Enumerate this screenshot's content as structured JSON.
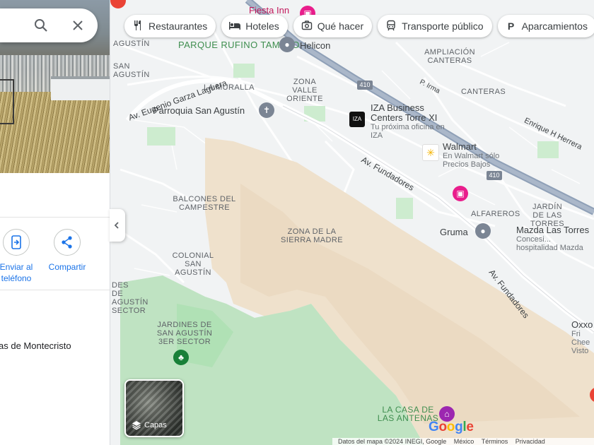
{
  "search": {
    "query": ""
  },
  "panel": {
    "actions": [
      {
        "label": "Enviar al\nteléfono"
      },
      {
        "label": "Compartir"
      }
    ],
    "address_fragment": "as de Montecristo"
  },
  "chips": [
    {
      "label": "Restaurantes",
      "icon": "restaurant-icon"
    },
    {
      "label": "Hoteles",
      "icon": "hotel-icon"
    },
    {
      "label": "Qué hacer",
      "icon": "camera-icon"
    },
    {
      "label": "Transporte público",
      "icon": "transit-icon"
    },
    {
      "label": "Aparcamientos",
      "icon": "parking-icon"
    }
  ],
  "map": {
    "areas": [
      "PARQUE RUFINO TAMAYO",
      "ZONA VALLE ORIENTE",
      "LA MURALLA",
      "AMPLIACIÓN CANTERAS",
      "CANTERAS",
      "BALCONES DEL CAMPESTRE",
      "ZONA DE LA SIERRA MADRE",
      "COLONIAL SAN AGUSTÍN",
      "JARDINES DE SAN AGUSTÍN 3ER SECTOR",
      "JARDÍN DE LAS TORRES",
      "ALFAREROS",
      "LA CASA DE LAS ANTENAS",
      "AGUSTÍN",
      "SAN AGUSTÍN",
      "DES DE AGUSTÍN SECTOR"
    ],
    "streets": [
      "Av. Eugenio Garza Laguera",
      "Av. Fundadores",
      "Av. Fundadores",
      "Enrique H Herrera",
      "P. Irma"
    ],
    "pois": [
      {
        "name": "Fiesta Inn",
        "sub": ""
      },
      {
        "name": "Helicon",
        "sub": ""
      },
      {
        "name": "Parroquia San Agustín",
        "sub": ""
      },
      {
        "name": "IZA Business Centers Torre XI",
        "sub": "Tu próxima oficina en IZA"
      },
      {
        "name": "Walmart",
        "sub": "En Walmart sólo Precios Bajos"
      },
      {
        "name": "Gruma",
        "sub": ""
      },
      {
        "name": "Mazda Las Torres",
        "sub": "Concesi... hospitalidad Mazda"
      },
      {
        "name": "Oxxo",
        "sub": "Fri Chee Visto"
      }
    ],
    "highway_shield": "410",
    "google_logo": "Google",
    "footer": [
      "Datos del mapa ©2024 INEGI, Google",
      "México",
      "Términos",
      "Privacidad"
    ]
  },
  "layers": {
    "label": "Capas"
  }
}
